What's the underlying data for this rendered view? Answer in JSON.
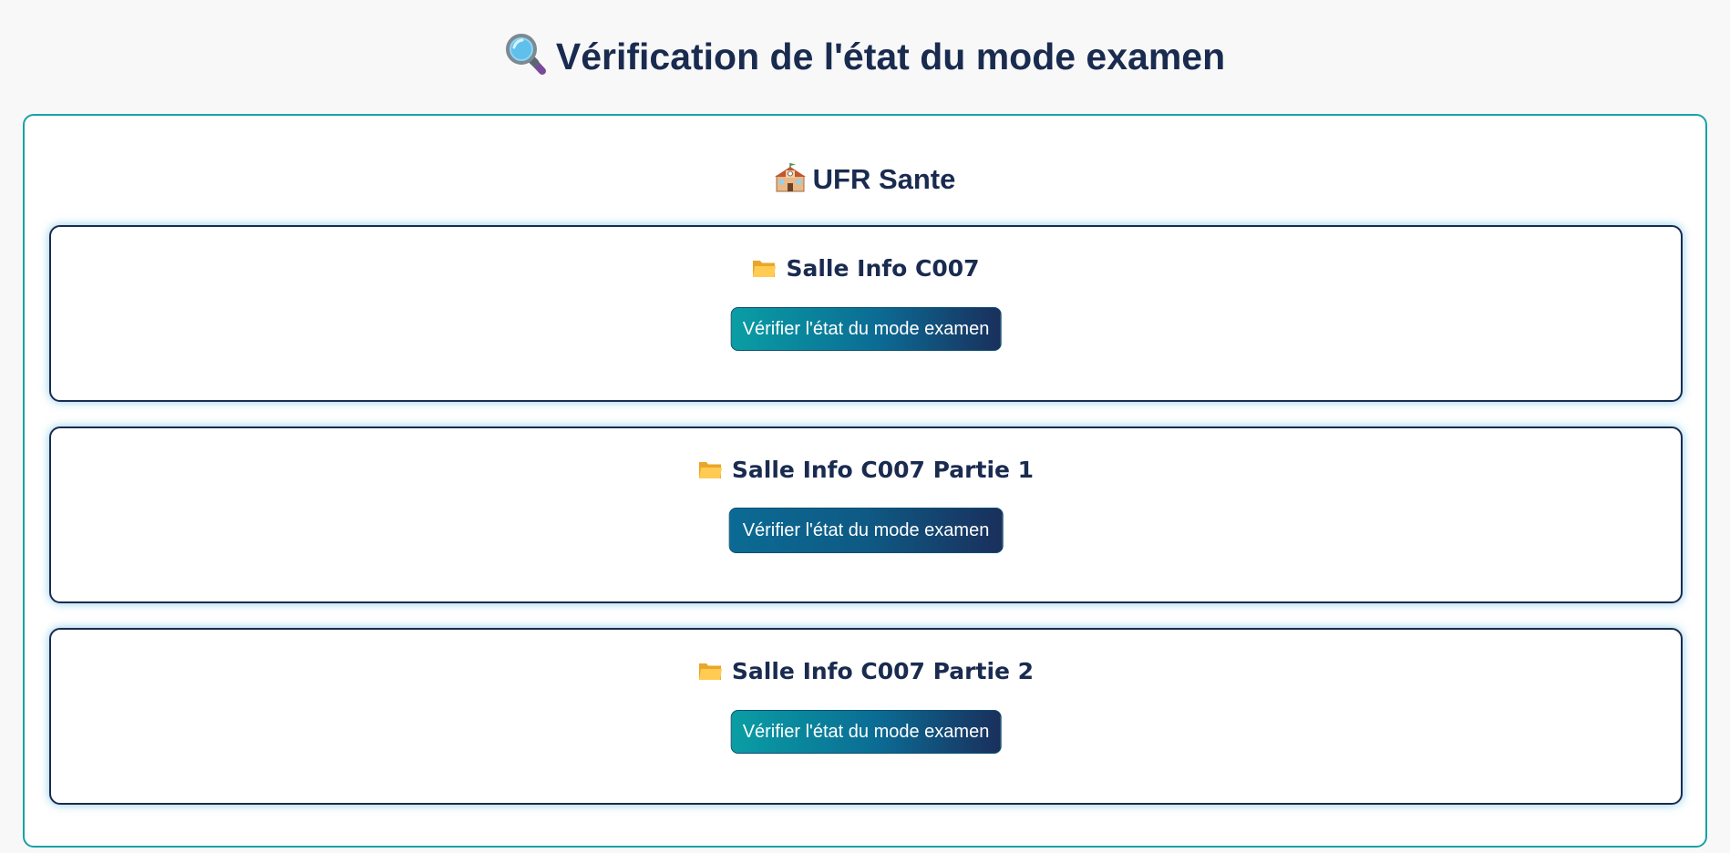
{
  "header": {
    "title": "Vérification de l'état du mode examen",
    "icon": "magnifier-icon"
  },
  "faculty": {
    "name": "UFR Sante",
    "icon": "school-icon",
    "rooms": [
      {
        "name": "Salle Info C007",
        "icon": "folder-icon",
        "button_label": "Vérifier l'état du mode examen"
      },
      {
        "name": "Salle Info C007 Partie 1",
        "icon": "folder-icon",
        "button_label": "Vérifier l'état du mode examen"
      },
      {
        "name": "Salle Info C007 Partie 2",
        "icon": "folder-icon",
        "button_label": "Vérifier l'état du mode examen"
      }
    ]
  },
  "colors": {
    "title_text": "#1a2b50",
    "faculty_border": "#17a2a6",
    "room_border": "#1a2b50",
    "button_gradient_start": "#0a9ea4",
    "button_gradient_end": "#1a2f5c"
  }
}
